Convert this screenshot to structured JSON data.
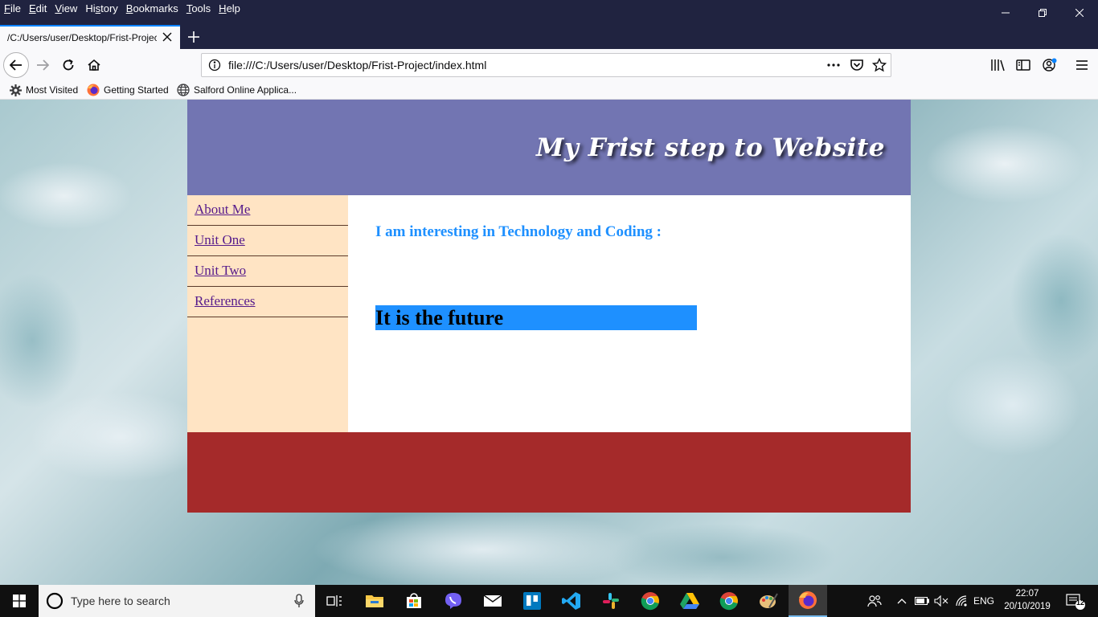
{
  "browser": {
    "menu": [
      {
        "pre": "",
        "ul": "F",
        "post": "ile"
      },
      {
        "pre": "",
        "ul": "E",
        "post": "dit"
      },
      {
        "pre": "",
        "ul": "V",
        "post": "iew"
      },
      {
        "pre": "Hi",
        "ul": "s",
        "post": "tory"
      },
      {
        "pre": "",
        "ul": "B",
        "post": "ookmarks"
      },
      {
        "pre": "",
        "ul": "T",
        "post": "ools"
      },
      {
        "pre": "",
        "ul": "H",
        "post": "elp"
      }
    ],
    "tab_title": "/C:/Users/user/Desktop/Frist-Project",
    "url": "file:///C:/Users/user/Desktop/Frist-Project/index.html",
    "bookmarks": [
      "Most Visited",
      "Getting Started",
      "Salford Online Applica..."
    ]
  },
  "page": {
    "site_title": "My Frist step to Website",
    "nav": [
      "About Me",
      "Unit One",
      "Unit Two",
      "References"
    ],
    "intro": "I am interesting in Technology and Coding :",
    "highlight": "It is the future"
  },
  "taskbar": {
    "search_placeholder": "Type here to search",
    "language": "ENG",
    "time": "22:07",
    "date": "20/10/2019",
    "notification_count": "12"
  },
  "colors": {
    "header": "#7275b2",
    "nav_bg": "#ffe4c4",
    "link": "#551a8b",
    "intro_text": "#1e90ff",
    "highlight_bg": "#1e90ff",
    "footer": "#a52a2a"
  }
}
